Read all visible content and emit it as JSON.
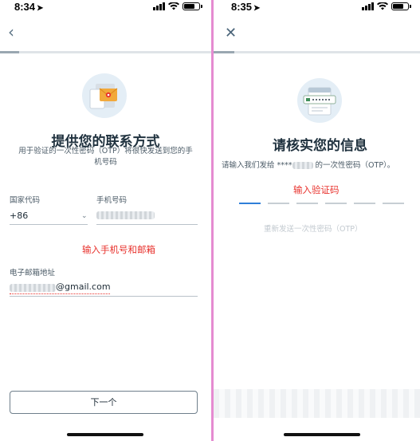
{
  "left": {
    "status": {
      "time": "8:34",
      "location_glyph": "➤"
    },
    "nav": {
      "back_glyph": "‹"
    },
    "progress": {
      "fraction": 0.09
    },
    "title": "提供您的联系方式",
    "subtitle_line1": "用于验证的一次性密码（OTP）将很快发送到您的手",
    "subtitle_line2": "机号码",
    "country_code_label": "国家代码",
    "country_code_value": "+86",
    "phone_label": "手机号码",
    "annotation": "输入手机号和邮箱",
    "email_label": "电子邮箱地址",
    "email_suffix": "@gmail.com",
    "next_button": "下一个"
  },
  "right": {
    "status": {
      "time": "8:35",
      "location_glyph": "➤"
    },
    "nav": {
      "close_glyph": "✕"
    },
    "progress": {
      "fraction": 0.1
    },
    "title": "请核实您的信息",
    "subtitle_prefix": "请输入我们发给 ****",
    "subtitle_suffix": " 的一次性密码（OTP）。",
    "annotation": "输入验证码",
    "otp_cells": 6,
    "resend": "重新发送一次性密码（OTP）"
  },
  "colors": {
    "divider": "#e58bd1",
    "annotation_red": "#e8322d",
    "otp_active": "#2f7fd8",
    "title": "#20323f"
  }
}
